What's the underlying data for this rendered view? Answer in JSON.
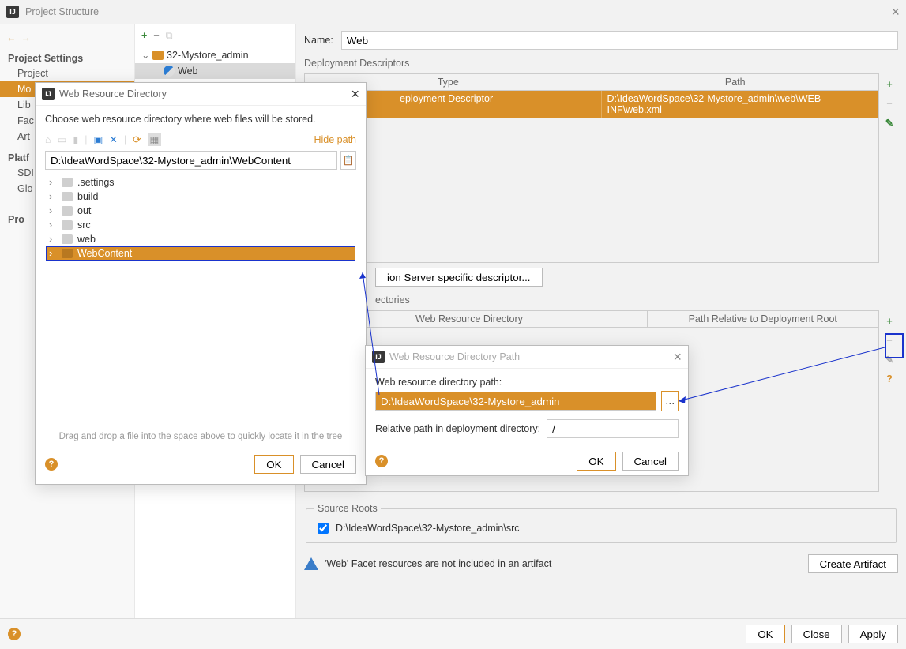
{
  "window": {
    "title": "Project Structure"
  },
  "sidebar": {
    "settings_head": "Project Settings",
    "items": [
      "Project",
      "Mo",
      "Lib",
      "Fac",
      "Art"
    ],
    "platform_head": "Platf",
    "platform_items": [
      "SDI",
      "Glo"
    ],
    "problems_head": "Pro"
  },
  "tree": {
    "module": "32-Mystore_admin",
    "facet": "Web"
  },
  "main": {
    "name_label": "Name:",
    "name_value": "Web",
    "dd_label": "Deployment Descriptors",
    "dd_headers": [
      "Type",
      "Path"
    ],
    "dd_row": {
      "type": "eployment Descriptor",
      "path": "D:\\IdeaWordSpace\\32-Mystore_admin\\web\\WEB-INF\\web.xml"
    },
    "add_specific_btn": "ion Server specific descriptor...",
    "wrd_label": "ectories",
    "wrd_headers": [
      "Web Resource Directory",
      "Path Relative to Deployment Root"
    ],
    "source_roots_legend": "Source Roots",
    "source_root_value": "D:\\IdeaWordSpace\\32-Mystore_admin\\src",
    "warning_text": "'Web' Facet resources are not included in an artifact",
    "create_artifact_btn": "Create Artifact"
  },
  "footer": {
    "ok": "OK",
    "cancel": "Close",
    "apply": "Apply"
  },
  "modal1": {
    "title": "Web Resource Directory",
    "prompt": "Choose web resource directory where web files will be stored.",
    "hide_path": "Hide path",
    "path_value": "D:\\IdeaWordSpace\\32-Mystore_admin\\WebContent",
    "dirs": [
      ".settings",
      "build",
      "out",
      "src",
      "web",
      "WebContent"
    ],
    "hint": "Drag and drop a file into the space above to quickly locate it in the tree",
    "ok": "OK",
    "cancel": "Cancel"
  },
  "modal2": {
    "title": "Web Resource Directory Path",
    "label1": "Web resource directory path:",
    "path_value": "D:\\IdeaWordSpace\\32-Mystore_admin",
    "label2": "Relative path in deployment directory:",
    "rel_value": "/",
    "ok": "OK",
    "cancel": "Cancel"
  }
}
